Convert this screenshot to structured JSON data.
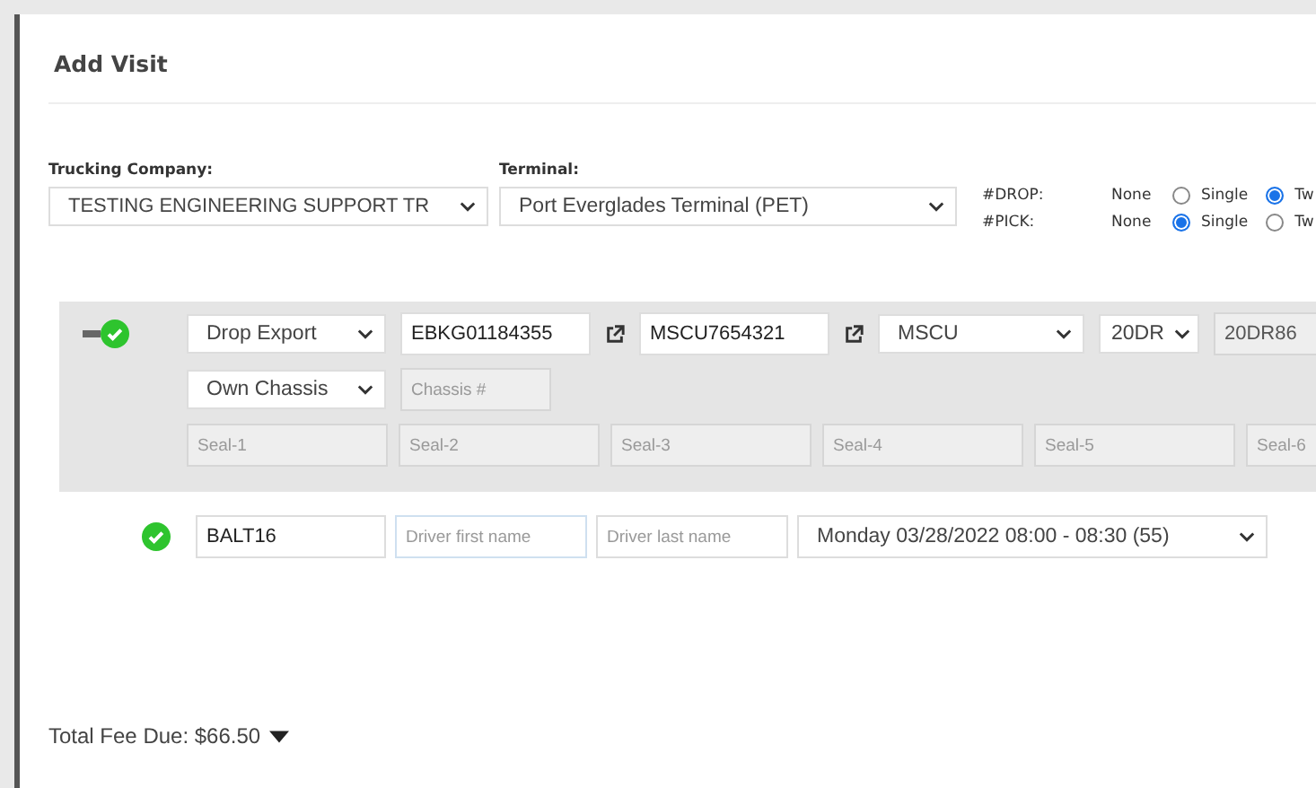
{
  "title": "Add Visit",
  "trucking_company": {
    "label": "Trucking Company:",
    "value": "TESTING ENGINEERING SUPPORT TR"
  },
  "terminal": {
    "label": "Terminal:",
    "value": "Port Everglades Terminal (PET)"
  },
  "counts": [
    {
      "label": "#DROP:",
      "none": "None",
      "options": [
        {
          "label": "Single",
          "selected": false
        },
        {
          "label": "Tw",
          "selected": true
        }
      ]
    },
    {
      "label": "#PICK:",
      "none": "None",
      "options": [
        {
          "label": "Single",
          "selected": true
        },
        {
          "label": "Tw",
          "selected": false
        }
      ]
    }
  ],
  "container": {
    "valid": true,
    "move": "Drop Export",
    "booking": "EBKG01184355",
    "container_no": "MSCU7654321",
    "line": "MSCU",
    "size": "20DR",
    "type": "20DR86",
    "chassis": "Own Chassis",
    "chassis_placeholder": "Chassis #",
    "seals": [
      {
        "placeholder": "Seal-1"
      },
      {
        "placeholder": "Seal-2"
      },
      {
        "placeholder": "Seal-3"
      },
      {
        "placeholder": "Seal-4"
      },
      {
        "placeholder": "Seal-5"
      },
      {
        "placeholder": "Seal-6"
      }
    ]
  },
  "driver": {
    "valid": true,
    "truck": "BALT16",
    "first_placeholder": "Driver first name",
    "last_placeholder": "Driver last name",
    "slot": "Monday 03/28/2022 08:00 - 08:30 (55)"
  },
  "total": "Total Fee Due: $66.50"
}
